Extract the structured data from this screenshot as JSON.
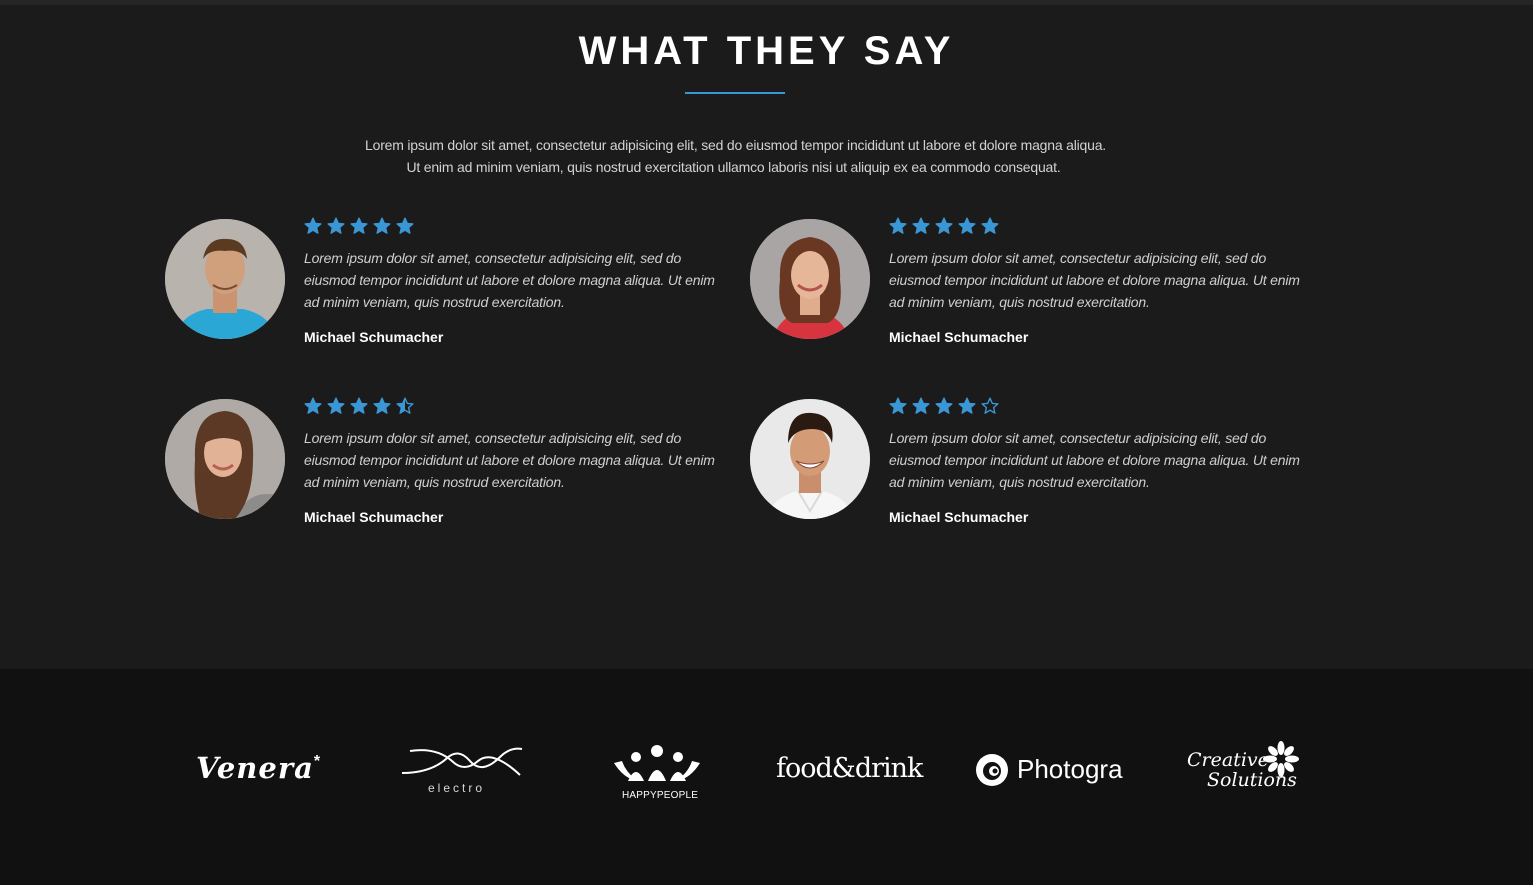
{
  "section": {
    "title": "WHAT THEY SAY",
    "intro_line1": "Lorem ipsum dolor sit amet, consectetur adipisicing elit, sed do eiusmod tempor incididunt ut labore et dolore magna aliqua.",
    "intro_line2": "Ut enim ad minim veniam, quis nostrud exercitation ullamco laboris nisi ut aliquip ex ea commodo consequat.",
    "accent_color": "#3a97d4"
  },
  "testimonials": [
    {
      "rating": 5,
      "quote": "Lorem ipsum dolor sit amet, consectetur adipisicing elit, sed do eiusmod tempor incididunt ut labore et dolore magna aliqua. Ut enim ad minim veniam, quis nostrud exercitation.",
      "author": "Michael Schumacher",
      "avatar": "man-blue-shirt"
    },
    {
      "rating": 5,
      "quote": "Lorem ipsum dolor sit amet, consectetur adipisicing elit, sed do eiusmod tempor incididunt ut labore et dolore magna aliqua. Ut enim ad minim veniam, quis nostrud exercitation.",
      "author": "Michael Schumacher",
      "avatar": "woman-red-top"
    },
    {
      "rating": 4.5,
      "quote": "Lorem ipsum dolor sit amet, consectetur adipisicing elit, sed do eiusmod tempor incididunt ut labore et dolore magna aliqua. Ut enim ad minim veniam, quis nostrud exercitation.",
      "author": "Michael Schumacher",
      "avatar": "woman-long-hair"
    },
    {
      "rating": 4,
      "quote": "Lorem ipsum dolor sit amet, consectetur adipisicing elit, sed do eiusmod tempor incididunt ut labore et dolore magna aliqua. Ut enim ad minim veniam, quis nostrud exercitation.",
      "author": "Michael Schumacher",
      "avatar": "man-smiling-white-shirt"
    }
  ],
  "logos": {
    "venera": "Venera",
    "electro": "electro",
    "happypeople": "HAPPYPEOPLE",
    "fooddrink": "food&drink",
    "photogra": "Photogra",
    "creative_line1": "Creative",
    "creative_line2": "Solutions"
  }
}
